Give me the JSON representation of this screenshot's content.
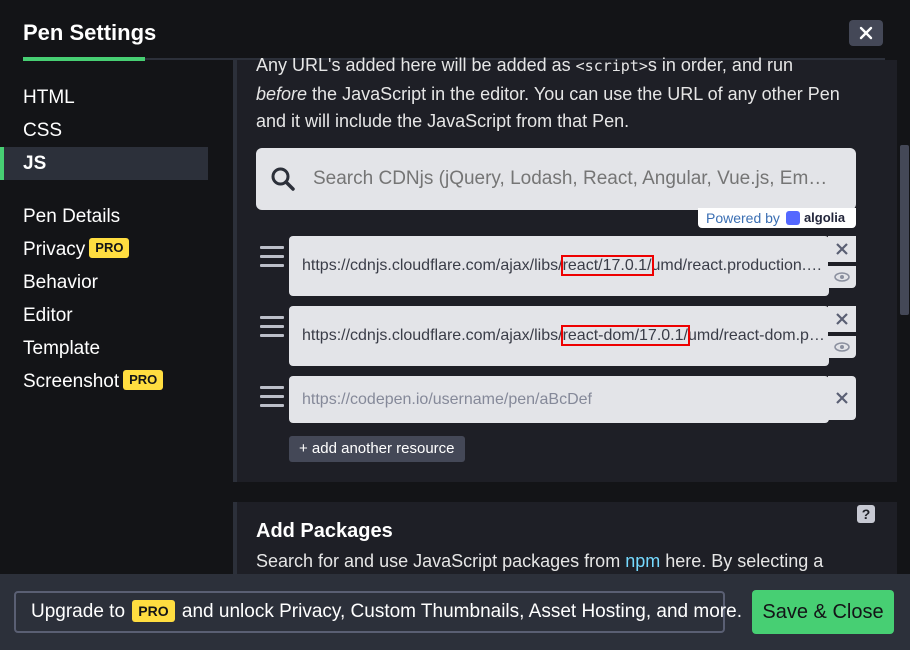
{
  "header": {
    "title": "Pen Settings",
    "close_label": "✕"
  },
  "sidebar": {
    "items": [
      {
        "label": "HTML"
      },
      {
        "label": "CSS"
      },
      {
        "label": "JS",
        "active": true
      },
      {
        "label": "Pen Details"
      },
      {
        "label": "Privacy",
        "badge": "PRO"
      },
      {
        "label": "Behavior"
      },
      {
        "label": "Editor"
      },
      {
        "label": "Template"
      },
      {
        "label": "Screenshot",
        "badge": "PRO"
      }
    ]
  },
  "external_scripts": {
    "desc_part1": "Any URL's added here will be added as ",
    "desc_code": "<script>",
    "desc_part2": "s in order, and run",
    "desc_em": "before",
    "desc_part3": " the JavaScript in the editor. You can use the URL of any other Pen and it will include the JavaScript from that Pen.",
    "search_placeholder": "Search CDNjs (jQuery, Lodash, React, Angular, Vue.js, Ember...",
    "powered_by": "Powered by",
    "algolia": "algolia",
    "resources": [
      {
        "prefix": "https://cdnjs.cloudflare.com/ajax/libs/",
        "highlight": "react/17.0.1/",
        "suffix": "umd/react.production.min.js"
      },
      {
        "prefix": "https://cdnjs.cloudflare.com/ajax/libs/",
        "highlight": "react-dom/17.0.1/",
        "suffix": "umd/react-dom.production.min.js"
      }
    ],
    "new_resource_placeholder": "https://codepen.io/username/pen/aBcDef",
    "add_resource_label": "+ add another resource"
  },
  "packages": {
    "title": "Add Packages",
    "desc_part1": "Search for and use JavaScript packages from ",
    "desc_link": "npm",
    "desc_part2": " here. By selecting a",
    "help": "?"
  },
  "footer": {
    "upgrade_part1": "Upgrade to ",
    "upgrade_badge": "PRO",
    "upgrade_part2": " and unlock Privacy, Custom Thumbnails, Asset Hosting, and more.",
    "save_label": "Save & Close"
  },
  "colors": {
    "accent": "#47cf73",
    "pro_badge": "#ffdd40",
    "highlight_box": "#e00000",
    "link": "#76daff"
  }
}
